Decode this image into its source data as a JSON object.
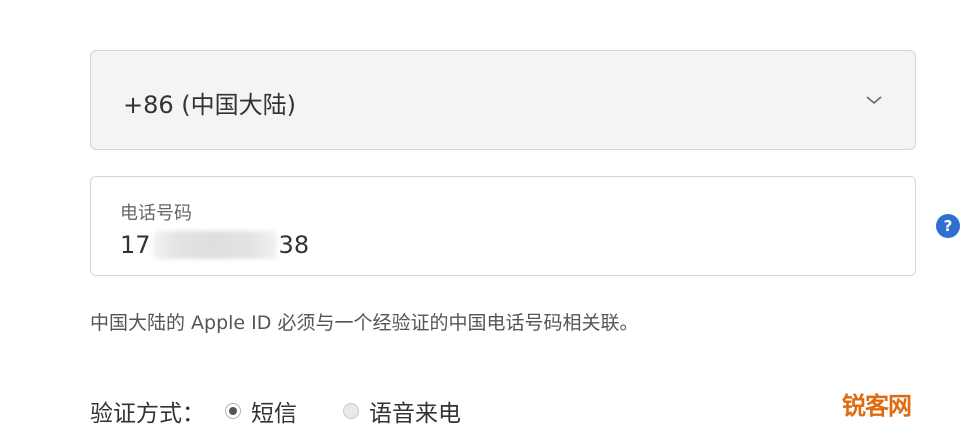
{
  "country_select": {
    "value": "+86 (中国大陆)",
    "icon": "chevron-down-icon"
  },
  "phone_field": {
    "label": "电话号码",
    "value_prefix": "17",
    "value_suffix": "38",
    "masked": true
  },
  "help": {
    "icon": "question-icon",
    "glyph": "?",
    "color": "#2f6fd1"
  },
  "note": "中国大陆的 Apple ID 必须与一个经验证的中国电话号码相关联。",
  "verification": {
    "label": "验证方式：",
    "options": [
      {
        "label": "短信",
        "selected": true
      },
      {
        "label": "语音来电",
        "selected": false
      }
    ]
  },
  "watermark": "锐客网"
}
